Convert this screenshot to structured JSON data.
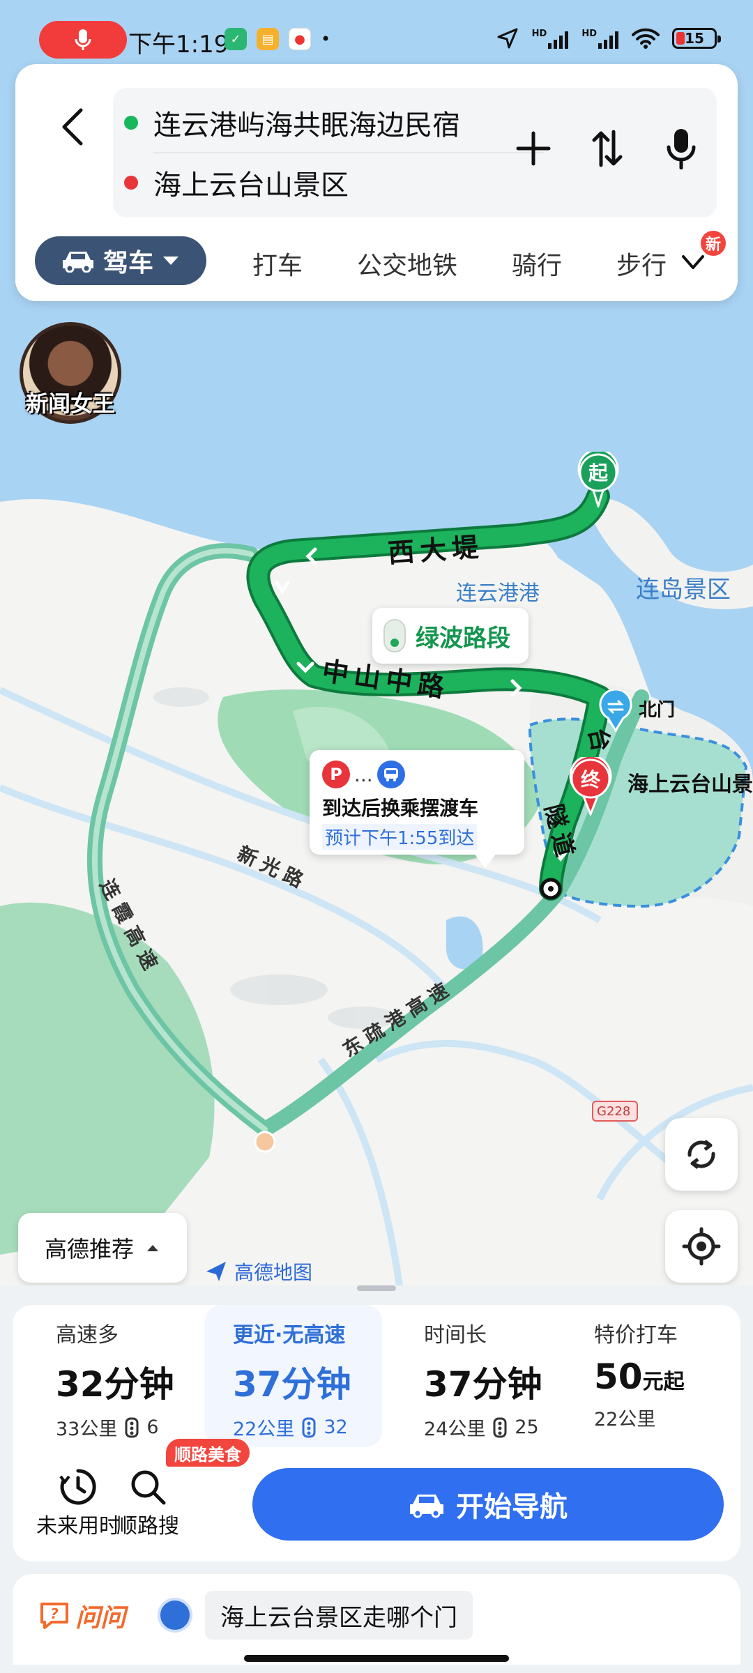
{
  "status_bar": {
    "time": "下午1:19",
    "network_1": "HD",
    "network_2": "HD",
    "battery": "15"
  },
  "route": {
    "start": "连云港屿海共眠海边民宿",
    "end": "海上云台山景区",
    "start_color": "#16b85a",
    "end_color": "#e8343b"
  },
  "modes": {
    "active": "驾车",
    "tabs": [
      "打车",
      "公交地铁",
      "骑行",
      "步行"
    ],
    "new_badge": "新"
  },
  "avatar": {
    "label": "新闻女王"
  },
  "map": {
    "roads": {
      "xidadi": "西大堤",
      "zhongshan": "中山中路",
      "xinguang": "新光路",
      "lianxia": "连霞高速",
      "dongshu": "东疏港高速",
      "tai": "台",
      "suidao": "隧道",
      "g228": "G228"
    },
    "places": {
      "lianyungang_port": "连云港港",
      "liandao": "连岛景区",
      "beimen": "北门",
      "scenic": "海上云台山景"
    },
    "green_wave": "绿波路段",
    "park_tip": {
      "dots": "...",
      "title": "到达后换乘摆渡车",
      "sub": "预计下午1:55到达"
    },
    "start_marker": "起",
    "end_marker": "终",
    "recommend": "高德推荐",
    "logo": "高德地图",
    "route_color": "#1db25c",
    "alt_route_color": "#6cc5a4"
  },
  "plans": [
    {
      "title": "高速多",
      "time": "32分钟",
      "distance": "33公里",
      "lights": "6"
    },
    {
      "title": "更近·无高速",
      "time": "37分钟",
      "distance": "22公里",
      "lights": "32"
    },
    {
      "title": "时间长",
      "time": "37分钟",
      "distance": "24公里",
      "lights": "25"
    },
    {
      "title": "特价打车",
      "time": "50",
      "time_unit": "元起",
      "distance": "22公里"
    }
  ],
  "actions": {
    "future": "未来用时",
    "along": "顺路搜",
    "food_badge": "顺路美食",
    "start_nav": "开始导航"
  },
  "ask": {
    "logo": "问问",
    "question": "海上云台景区走哪个门"
  }
}
